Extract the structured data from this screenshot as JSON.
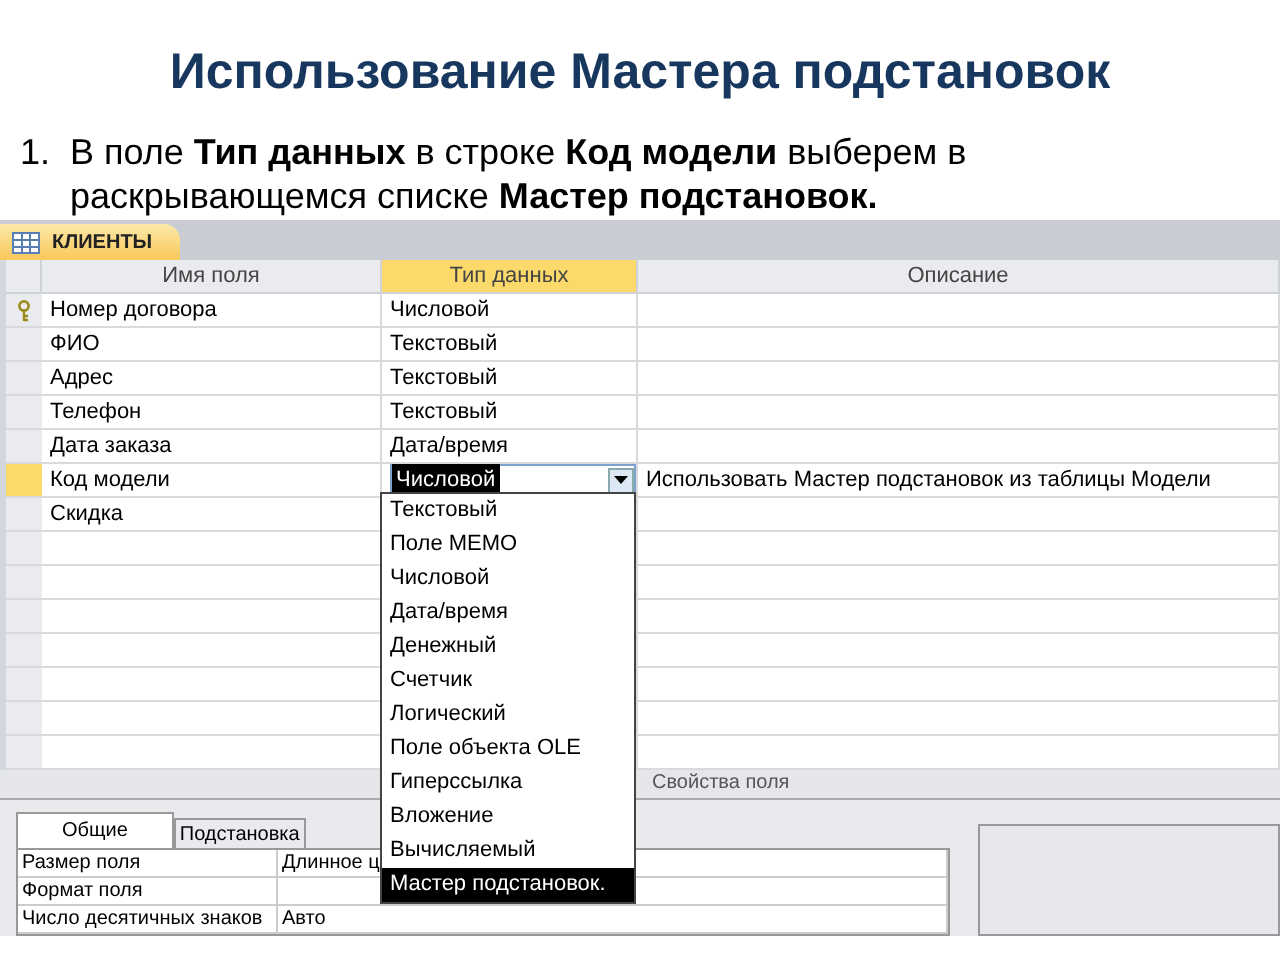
{
  "slide": {
    "title": "Использование Мастера подстановок",
    "step_number": "1.",
    "instruction": "В поле **Тип данных** в строке **Код модели** выберем в раскрывающемся списке **Мастер подстановок.**"
  },
  "window": {
    "tab": "КЛИЕНТЫ"
  },
  "table": {
    "columns": [
      "Имя поля",
      "Тип данных",
      "Описание"
    ],
    "rows": [
      {
        "name": "Номер договора",
        "type": "Числовой",
        "description": "",
        "primary_key": true,
        "current": false
      },
      {
        "name": "ФИО",
        "type": "Текстовый",
        "description": "",
        "primary_key": false,
        "current": false
      },
      {
        "name": "Адрес",
        "type": "Текстовый",
        "description": "",
        "primary_key": false,
        "current": false
      },
      {
        "name": "Телефон",
        "type": "Текстовый",
        "description": "",
        "primary_key": false,
        "current": false
      },
      {
        "name": "Дата заказа",
        "type": "Дата/время",
        "description": "",
        "primary_key": false,
        "current": false
      },
      {
        "name": "Код модели",
        "type": "Числовой",
        "description": "Использовать Мастер подстановок из таблицы Модели",
        "primary_key": false,
        "current": true
      },
      {
        "name": "Скидка",
        "type": "",
        "description": "",
        "primary_key": false,
        "current": false
      }
    ]
  },
  "dropdown": {
    "options": [
      {
        "label": "Текстовый",
        "selected": false
      },
      {
        "label": "Поле MEMO",
        "selected": false
      },
      {
        "label": "Числовой",
        "selected": false
      },
      {
        "label": "Дата/время",
        "selected": false
      },
      {
        "label": "Денежный",
        "selected": false
      },
      {
        "label": "Счетчик",
        "selected": false
      },
      {
        "label": "Логический",
        "selected": false
      },
      {
        "label": "Поле объекта OLE",
        "selected": false
      },
      {
        "label": "Гиперссылка",
        "selected": false
      },
      {
        "label": "Вложение",
        "selected": false
      },
      {
        "label": "Вычисляемый",
        "selected": false
      },
      {
        "label": "Мастер подстановок.",
        "selected": true
      }
    ]
  },
  "properties": {
    "title": "Свойства поля",
    "tabs": [
      {
        "label": "Общие",
        "selected": true
      },
      {
        "label": "Подстановка",
        "selected": false
      }
    ],
    "rows": [
      {
        "name": "Размер поля",
        "value": "Длинное ц"
      },
      {
        "name": "Формат поля",
        "value": ""
      },
      {
        "name": "Число десятичных знаков",
        "value": "Авто"
      }
    ]
  }
}
